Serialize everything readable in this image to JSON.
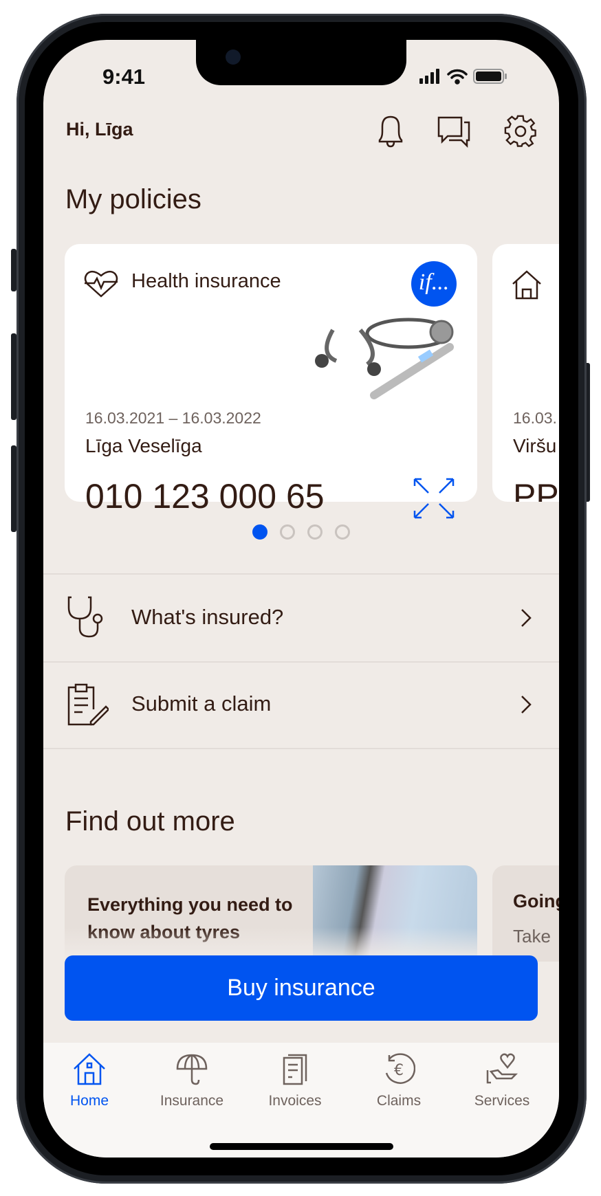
{
  "status_bar": {
    "time": "9:41"
  },
  "header": {
    "greeting": "Hi, Līga"
  },
  "policies": {
    "title": "My policies",
    "cards": [
      {
        "type": "Health insurance",
        "dates": "16.03.2021 – 16.03.2022",
        "holder": "Līga Veselīga",
        "number": "010 123 000 65",
        "logo": "if..."
      },
      {
        "dates": "16.03.",
        "holder": "Viršu",
        "number": "PP"
      }
    ],
    "pagination": {
      "total": 4,
      "active": 1
    }
  },
  "actions": [
    {
      "label": "What's insured?"
    },
    {
      "label": "Submit a claim"
    }
  ],
  "find_out_more": {
    "title": "Find out more",
    "articles": [
      {
        "title": "Everything you need to know about tyres"
      },
      {
        "title": "Going",
        "subtitle": "Take"
      }
    ]
  },
  "buy_button": "Buy insurance",
  "nav": [
    {
      "label": "Home",
      "active": true
    },
    {
      "label": "Insurance"
    },
    {
      "label": "Invoices"
    },
    {
      "label": "Claims"
    },
    {
      "label": "Services"
    }
  ],
  "colors": {
    "accent": "#0054f0",
    "text": "#331c14",
    "background": "#f0ebe7"
  }
}
